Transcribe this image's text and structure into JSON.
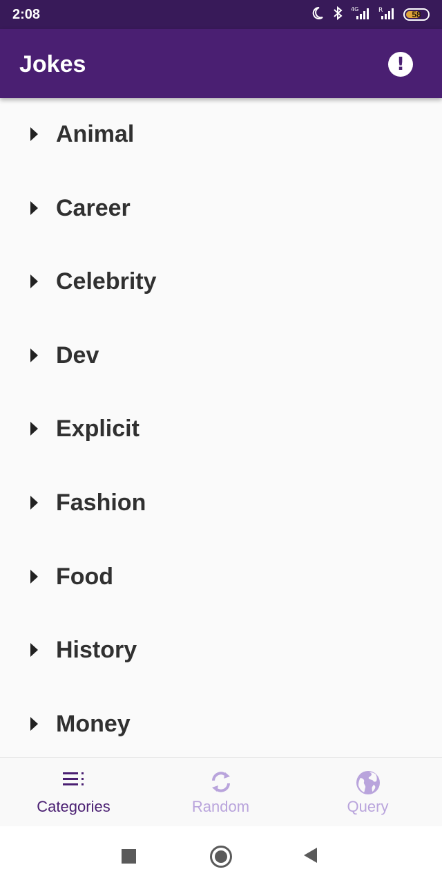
{
  "status_bar": {
    "time": "2:08",
    "icons": [
      "moon-icon",
      "bluetooth-icon",
      "signal-4g-icon",
      "signal-r-icon"
    ],
    "battery": "58"
  },
  "app_bar": {
    "title": "Jokes",
    "info_icon_glyph": "!"
  },
  "categories": [
    {
      "label": "Animal"
    },
    {
      "label": "Career"
    },
    {
      "label": "Celebrity"
    },
    {
      "label": "Dev"
    },
    {
      "label": "Explicit"
    },
    {
      "label": "Fashion"
    },
    {
      "label": "Food"
    },
    {
      "label": "History"
    },
    {
      "label": "Money"
    }
  ],
  "bottom_nav": {
    "items": [
      {
        "label": "Categories",
        "icon": "list-icon",
        "active": true
      },
      {
        "label": "Random",
        "icon": "refresh-icon",
        "active": false
      },
      {
        "label": "Query",
        "icon": "globe-icon",
        "active": false
      }
    ]
  },
  "colors": {
    "status_bar": "#381a59",
    "app_bar": "#4a1f72",
    "active": "#4a1f72",
    "inactive": "#b9a4dc",
    "background": "#fafafa",
    "battery_fill": "#e0a43a"
  }
}
